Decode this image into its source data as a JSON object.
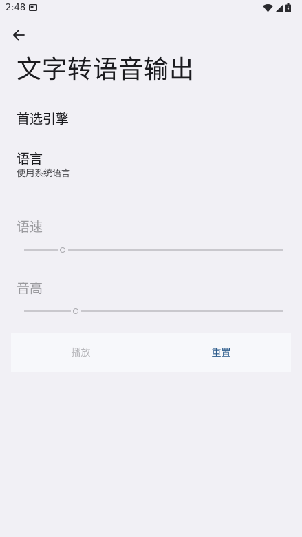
{
  "status_bar": {
    "time": "2:48"
  },
  "header": {
    "title": "文字转语音输出"
  },
  "preferences": {
    "engine": {
      "title": "首选引擎"
    },
    "language": {
      "title": "语言",
      "summary": "使用系统语言"
    }
  },
  "sliders": {
    "speech_rate": {
      "label": "语速",
      "value": 0.15
    },
    "pitch": {
      "label": "音高",
      "value": 0.2
    }
  },
  "buttons": {
    "play_label": "播放",
    "reset_label": "重置"
  },
  "colors": {
    "background": "#f1f0f5",
    "accent": "#2a5a8a",
    "disabled": "#b7b7bb"
  }
}
